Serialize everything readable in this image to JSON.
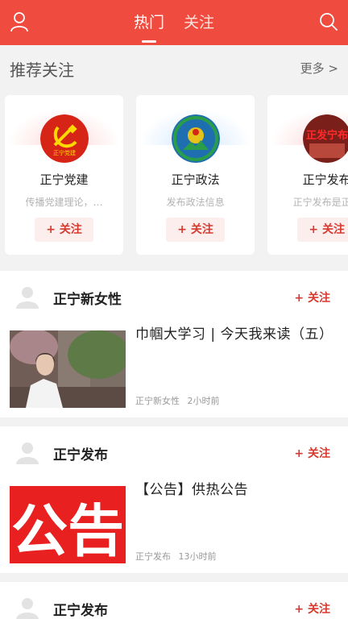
{
  "header": {
    "tabs": [
      {
        "label": "热门"
      },
      {
        "label": "关注"
      }
    ]
  },
  "recommend": {
    "title": "推荐关注",
    "more": "更多 >",
    "cards": [
      {
        "name": "正宁党建",
        "desc": "传播党建理论，…",
        "follow": "+ 关注",
        "logo_text": "正宁党建"
      },
      {
        "name": "正宁政法",
        "desc": "发布政法信息",
        "follow": "+ 关注"
      },
      {
        "name": "正宁发布",
        "desc": "正宁发布是正宁",
        "follow": "+ 关注",
        "logo_text": "正发宁布"
      }
    ]
  },
  "feed": [
    {
      "name": "正宁新女性",
      "follow": "+ 关注",
      "title": "巾帼大学习 | 今天我来读（五）",
      "source": "正宁新女性",
      "time": "2小时前"
    },
    {
      "name": "正宁发布",
      "follow": "+ 关注",
      "title": "【公告】供热公告",
      "source": "正宁发布",
      "time": "13小时前",
      "thumb_text": "公告"
    },
    {
      "name": "正宁发布",
      "follow": "+ 关注"
    }
  ],
  "colors": {
    "brand": "#ef4b3f",
    "accent": "#d7392e"
  }
}
